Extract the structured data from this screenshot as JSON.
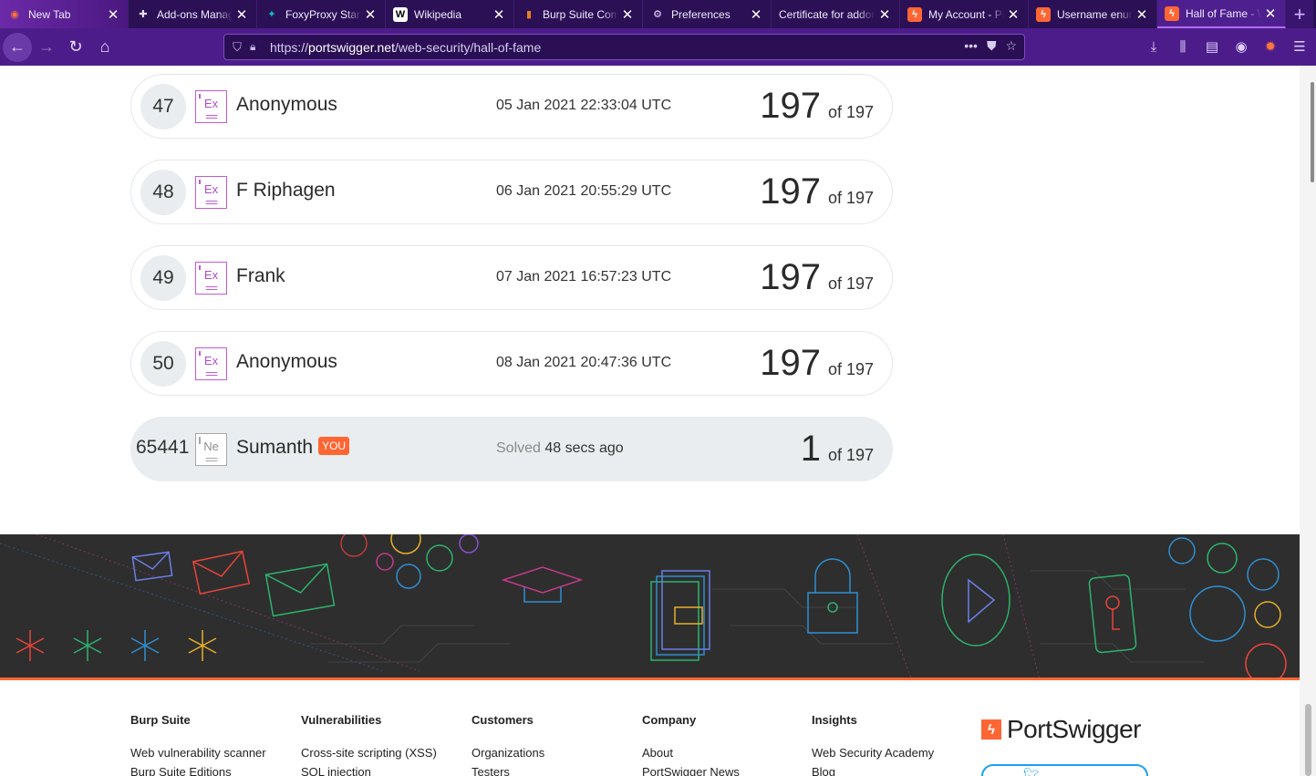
{
  "browser": {
    "tabs": [
      {
        "title": "New Tab",
        "icon": "firefox-icon",
        "color": "#ff7139"
      },
      {
        "title": "Add-ons Manager",
        "icon": "puzzle-icon",
        "color": "#e8dcff"
      },
      {
        "title": "FoxyProxy Standard",
        "icon": "foxyproxy-icon",
        "color": "#00c7c7"
      },
      {
        "title": "Wikipedia",
        "icon": "wikipedia-icon",
        "color": "#ffffff"
      },
      {
        "title": "Burp Suite Community",
        "icon": "burp-icon",
        "color": "#e67e22"
      },
      {
        "title": "Preferences",
        "icon": "gear-icon",
        "color": "#e8dcff"
      },
      {
        "title": "Certificate for addons",
        "icon": "",
        "color": ""
      },
      {
        "title": "My Account - PortSwigger",
        "icon": "portswigger-icon",
        "color": "#ff6633"
      },
      {
        "title": "Username enumeration",
        "icon": "portswigger-icon",
        "color": "#ff6633"
      },
      {
        "title": "Hall of Fame - Web Security",
        "icon": "portswigger-icon",
        "color": "#ff6633"
      }
    ],
    "url_prefix": "https://",
    "url_domain": "portswigger.net",
    "url_path": "/web-security/hall-of-fame"
  },
  "leaderboard": [
    {
      "rank": "47",
      "badge": "Ex",
      "name": "Anonymous",
      "date": "05 Jan 2021 22:33:04 UTC",
      "score": "197",
      "of": "of 197"
    },
    {
      "rank": "48",
      "badge": "Ex",
      "name": "F Riphagen",
      "date": "06 Jan 2021 20:55:29 UTC",
      "score": "197",
      "of": "of 197"
    },
    {
      "rank": "49",
      "badge": "Ex",
      "name": "Frank",
      "date": "07 Jan 2021 16:57:23 UTC",
      "score": "197",
      "of": "of 197"
    },
    {
      "rank": "50",
      "badge": "Ex",
      "name": "Anonymous",
      "date": "08 Jan 2021 20:47:36 UTC",
      "score": "197",
      "of": "of 197"
    }
  ],
  "current_user": {
    "rank": "65441",
    "badge": "Ne",
    "name": "Sumanth",
    "you_label": "YOU",
    "solved_label": "Solved",
    "solved_time": "48 secs ago",
    "score": "1",
    "of": "of 197"
  },
  "footer": {
    "columns": [
      {
        "heading": "Burp Suite",
        "links": [
          "Web vulnerability scanner",
          "Burp Suite Editions"
        ]
      },
      {
        "heading": "Vulnerabilities",
        "links": [
          "Cross-site scripting (XSS)",
          "SQL injection"
        ]
      },
      {
        "heading": "Customers",
        "links": [
          "Organizations",
          "Testers"
        ]
      },
      {
        "heading": "Company",
        "links": [
          "About",
          "PortSwigger News"
        ]
      },
      {
        "heading": "Insights",
        "links": [
          "Web Security Academy",
          "Blog"
        ]
      }
    ],
    "logo_text": "PortSwigger"
  },
  "colors": {
    "accent": "#ff6633",
    "expert_badge": "#c05ad6",
    "browser_purple": "#4c1d8a"
  }
}
